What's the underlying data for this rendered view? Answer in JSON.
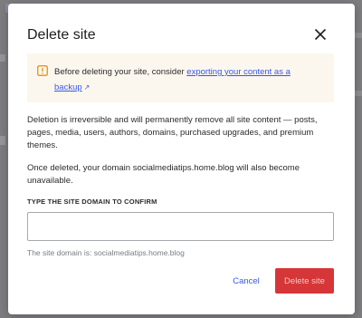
{
  "dialog": {
    "title": "Delete site",
    "close_icon": "close-icon"
  },
  "notice": {
    "icon": "warning-icon",
    "text_before": "Before deleting your site, consider ",
    "link_text": "exporting your content as a backup",
    "external_icon": "↗"
  },
  "body": {
    "paragraph1": "Deletion is irreversible and will permanently remove all site content — posts, pages, media, users, authors, domains, purchased upgrades, and premium themes.",
    "paragraph2": "Once deleted, your domain socialmediatips.home.blog will also become unavailable."
  },
  "confirm": {
    "label": "TYPE THE SITE DOMAIN TO CONFIRM",
    "value": "",
    "hint": "The site domain is: socialmediatips.home.blog"
  },
  "actions": {
    "cancel_label": "Cancel",
    "delete_label": "Delete site",
    "delete_color": "#d63638"
  },
  "colors": {
    "accent": "#3858e9",
    "notice_bg": "#fcf7ee",
    "warning": "#e08c00"
  }
}
